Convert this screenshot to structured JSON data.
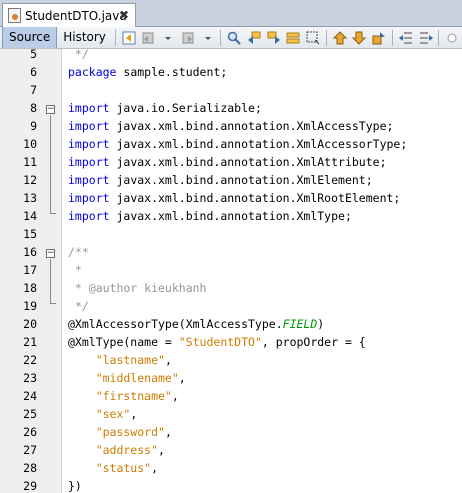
{
  "tab": {
    "filename": "StudentDTO.java",
    "close_glyph": "✖"
  },
  "toolbar": {
    "source_label": "Source",
    "history_label": "History"
  },
  "editor": {
    "lines": [
      {
        "num": "5",
        "segments": [
          {
            "t": " */",
            "c": "cmt"
          }
        ]
      },
      {
        "num": "6",
        "segments": [
          {
            "t": "package",
            "c": "kw"
          },
          {
            "t": " sample.student;",
            "c": "plain"
          }
        ]
      },
      {
        "num": "7",
        "segments": []
      },
      {
        "num": "8",
        "segments": [
          {
            "t": "import",
            "c": "kw"
          },
          {
            "t": " java.io.Serializable;",
            "c": "plain"
          }
        ]
      },
      {
        "num": "9",
        "segments": [
          {
            "t": "import",
            "c": "kw"
          },
          {
            "t": " javax.xml.bind.annotation.XmlAccessType;",
            "c": "plain"
          }
        ]
      },
      {
        "num": "10",
        "segments": [
          {
            "t": "import",
            "c": "kw"
          },
          {
            "t": " javax.xml.bind.annotation.XmlAccessorType;",
            "c": "plain"
          }
        ]
      },
      {
        "num": "11",
        "segments": [
          {
            "t": "import",
            "c": "kw"
          },
          {
            "t": " javax.xml.bind.annotation.XmlAttribute;",
            "c": "plain"
          }
        ]
      },
      {
        "num": "12",
        "segments": [
          {
            "t": "import",
            "c": "kw"
          },
          {
            "t": " javax.xml.bind.annotation.XmlElement;",
            "c": "plain"
          }
        ]
      },
      {
        "num": "13",
        "segments": [
          {
            "t": "import",
            "c": "kw"
          },
          {
            "t": " javax.xml.bind.annotation.XmlRootElement;",
            "c": "plain"
          }
        ]
      },
      {
        "num": "14",
        "segments": [
          {
            "t": "import",
            "c": "kw"
          },
          {
            "t": " javax.xml.bind.annotation.XmlType;",
            "c": "plain"
          }
        ]
      },
      {
        "num": "15",
        "segments": []
      },
      {
        "num": "16",
        "segments": [
          {
            "t": "/**",
            "c": "cmt"
          }
        ]
      },
      {
        "num": "17",
        "segments": [
          {
            "t": " *",
            "c": "cmt"
          }
        ]
      },
      {
        "num": "18",
        "segments": [
          {
            "t": " * @author kieukhanh",
            "c": "cmt"
          }
        ]
      },
      {
        "num": "19",
        "segments": [
          {
            "t": " */",
            "c": "cmt"
          }
        ]
      },
      {
        "num": "20",
        "segments": [
          {
            "t": "@XmlAccessorType(XmlAccessType.",
            "c": "ann"
          },
          {
            "t": "FIELD",
            "c": "field"
          },
          {
            "t": ")",
            "c": "ann"
          }
        ]
      },
      {
        "num": "21",
        "segments": [
          {
            "t": "@XmlType(name = ",
            "c": "ann"
          },
          {
            "t": "\"StudentDTO\"",
            "c": "str"
          },
          {
            "t": ", propOrder = {",
            "c": "plain"
          }
        ]
      },
      {
        "num": "22",
        "segments": [
          {
            "t": "    \"lastname\"",
            "c": "str"
          },
          {
            "t": ",",
            "c": "plain"
          }
        ]
      },
      {
        "num": "23",
        "segments": [
          {
            "t": "    \"middlename\"",
            "c": "str"
          },
          {
            "t": ",",
            "c": "plain"
          }
        ]
      },
      {
        "num": "24",
        "segments": [
          {
            "t": "    \"firstname\"",
            "c": "str"
          },
          {
            "t": ",",
            "c": "plain"
          }
        ]
      },
      {
        "num": "25",
        "segments": [
          {
            "t": "    \"sex\"",
            "c": "str"
          },
          {
            "t": ",",
            "c": "plain"
          }
        ]
      },
      {
        "num": "26",
        "segments": [
          {
            "t": "    \"password\"",
            "c": "str"
          },
          {
            "t": ",",
            "c": "plain"
          }
        ]
      },
      {
        "num": "27",
        "segments": [
          {
            "t": "    \"address\"",
            "c": "str"
          },
          {
            "t": ",",
            "c": "plain"
          }
        ]
      },
      {
        "num": "28",
        "segments": [
          {
            "t": "    \"status\"",
            "c": "str"
          },
          {
            "t": ",",
            "c": "plain"
          }
        ]
      },
      {
        "num": "29",
        "segments": [
          {
            "t": "})",
            "c": "plain"
          }
        ]
      }
    ],
    "colors": {
      "keyword": "#0000e6",
      "string": "#ce7b00",
      "comment": "#969696",
      "enum_field": "#009900"
    }
  }
}
